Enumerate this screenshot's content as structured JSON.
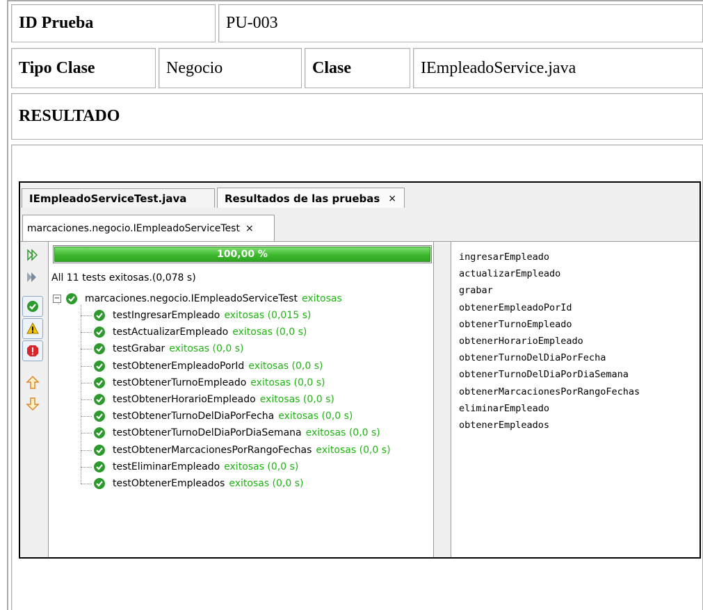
{
  "table": {
    "id_label": "ID Prueba",
    "id_value": "PU-003",
    "tipo_label": "Tipo Clase",
    "tipo_value": "Negocio",
    "clase_label": "Clase",
    "clase_value": "IEmpleadoService.java",
    "resultado_label": "RESULTADO"
  },
  "ide": {
    "tabs": [
      {
        "label": "IEmpleadoServiceTest.java",
        "active": false
      },
      {
        "label": "Resultados de las pruebas",
        "active": true,
        "close": "×"
      }
    ],
    "subtab": {
      "label": "marcaciones.negocio.IEmpleadoServiceTest",
      "close": "×"
    },
    "progress": {
      "label": "100,00 %",
      "value": 1.0,
      "color": "#3db82e"
    },
    "summary": "All 11 tests exitosas.(0,078 s)",
    "suite": {
      "name": "marcaciones.negocio.IEmpleadoServiceTest",
      "status": "exitosas"
    },
    "tests": [
      {
        "name": "testIngresarEmpleado",
        "status": "exitosas (0,015 s)"
      },
      {
        "name": "testActualizarEmpleado",
        "status": "exitosas (0,0 s)"
      },
      {
        "name": "testGrabar",
        "status": "exitosas (0,0 s)"
      },
      {
        "name": "testObtenerEmpleadoPorId",
        "status": "exitosas (0,0 s)"
      },
      {
        "name": "testObtenerTurnoEmpleado",
        "status": "exitosas (0,0 s)"
      },
      {
        "name": "testObtenerHorarioEmpleado",
        "status": "exitosas (0,0 s)"
      },
      {
        "name": "testObtenerTurnoDelDiaPorFecha",
        "status": "exitosas (0,0 s)"
      },
      {
        "name": "testObtenerTurnoDelDiaPorDiaSemana",
        "status": "exitosas (0,0 s)"
      },
      {
        "name": "testObtenerMarcacionesPorRangoFechas",
        "status": "exitosas (0,0 s)"
      },
      {
        "name": "testEliminarEmpleado",
        "status": "exitosas (0,0 s)"
      },
      {
        "name": "testObtenerEmpleados",
        "status": "exitosas (0,0 s)"
      }
    ],
    "output_lines": [
      "ingresarEmpleado",
      "actualizarEmpleado",
      "grabar",
      "obtenerEmpleadoPorId",
      "obtenerTurnoEmpleado",
      "obtenerHorarioEmpleado",
      "obtenerTurnoDelDiaPorFecha",
      "obtenerTurnoDelDiaPorDiaSemana",
      "obtenerMarcacionesPorRangoFechas",
      "eliminarEmpleado",
      "obtenerEmpleados"
    ],
    "toolbar_icons": [
      "rerun-icon",
      "rerun-failed-icon",
      "show-passed-icon",
      "show-warnings-icon",
      "show-errors-icon",
      "previous-failure-icon",
      "next-failure-icon"
    ]
  }
}
